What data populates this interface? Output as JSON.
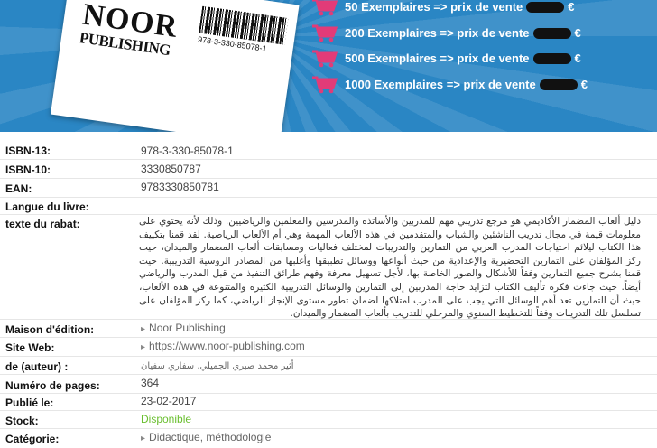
{
  "banner": {
    "publisher_logo_line1": "NOOR",
    "publisher_logo_line2": "PUBLISHING",
    "barcode_number": "978-3-330-85078-1",
    "price_rows": [
      {
        "label": "50 Exemplaires => prix de vente",
        "currency": "€"
      },
      {
        "label": "200 Exemplaires => prix de vente",
        "currency": "€"
      },
      {
        "label": "500 Exemplaires => prix de vente",
        "currency": "€"
      },
      {
        "label": "1000 Exemplaires => prix de vente",
        "currency": "€"
      }
    ],
    "cart_icon": "shopping-cart-icon",
    "colors": {
      "background": "#2a86c4",
      "cart": "#e23b78"
    }
  },
  "details": {
    "isbn13_label": "ISBN-13:",
    "isbn13_value": "978-3-330-85078-1",
    "isbn10_label": "ISBN-10:",
    "isbn10_value": "3330850787",
    "ean_label": "EAN:",
    "ean_value": "9783330850781",
    "langue_label": "Langue du livre:",
    "rabat_label": "texte du rabat:",
    "rabat_text": "دليل ألعاب المضمار الأكاديمي هو مرجع تدريبي مهم للمدربين والأساتذة والمدرسين والمعلمين والرياضيين. وذلك لأنه يحتوي على معلومات قيمة في مجال تدريب الناشئين والشباب والمتقدمين في هذه الألعاب المهمة وهي أم الألعاب الرياضية. لقد قمنا بتكييف هذا الكتاب ليلائم احتياجات المدرب العربي من التمارين والتدريبات لمختلف فعاليات ومسابقات ألعاب المضمار والميدان، حيث ركز المؤلفان على التمارين التحضيرية والإعدادية من حيث أنواعها ووسائل تطبيقها وأغلبها من المصادر الروسية التدريبية. حيث قمنا بشرح جميع التمارين وفقاً للأشكال والصور الخاصة بها، لأجل تسهيل معرفة وفهم طرائق التنفيذ من قبل المدرب والرياضي أيضاً. حيث جاءت فكرة تأليف الكتاب لتزايد حاجة المدربين إلى التمارين والوسائل التدريبية الكثيرة والمتنوعة في هذه الألعاب، حيث أن التمارين تعد أهم الوسائل التي يجب على المدرب امتلاكها لضمان تطور مستوى الإنجاز الرياضي، كما ركز المؤلفان على تسلسل تلك التدريبات وفقاً للتخطيط السنوي والمرحلي للتدريب بألعاب المضمار والميدان.",
    "maison_label": "Maison d'édition:",
    "maison_value": "Noor Publishing",
    "site_label": "Site Web:",
    "site_value": "https://www.noor-publishing.com",
    "auteur_label": "de (auteur) :",
    "auteur_value": "أثير محمد صبري الجميلي, سفاري سفيان",
    "pages_label": "Numéro de pages:",
    "pages_value": "364",
    "publie_label": "Publié le:",
    "publie_value": "23-02-2017",
    "stock_label": "Stock:",
    "stock_value": "Disponible",
    "categorie_label": "Catégorie:",
    "categorie_value": "Didactique, méthodologie",
    "link_icon": "triangle-right-icon",
    "stock_color": "#6abf2f"
  }
}
